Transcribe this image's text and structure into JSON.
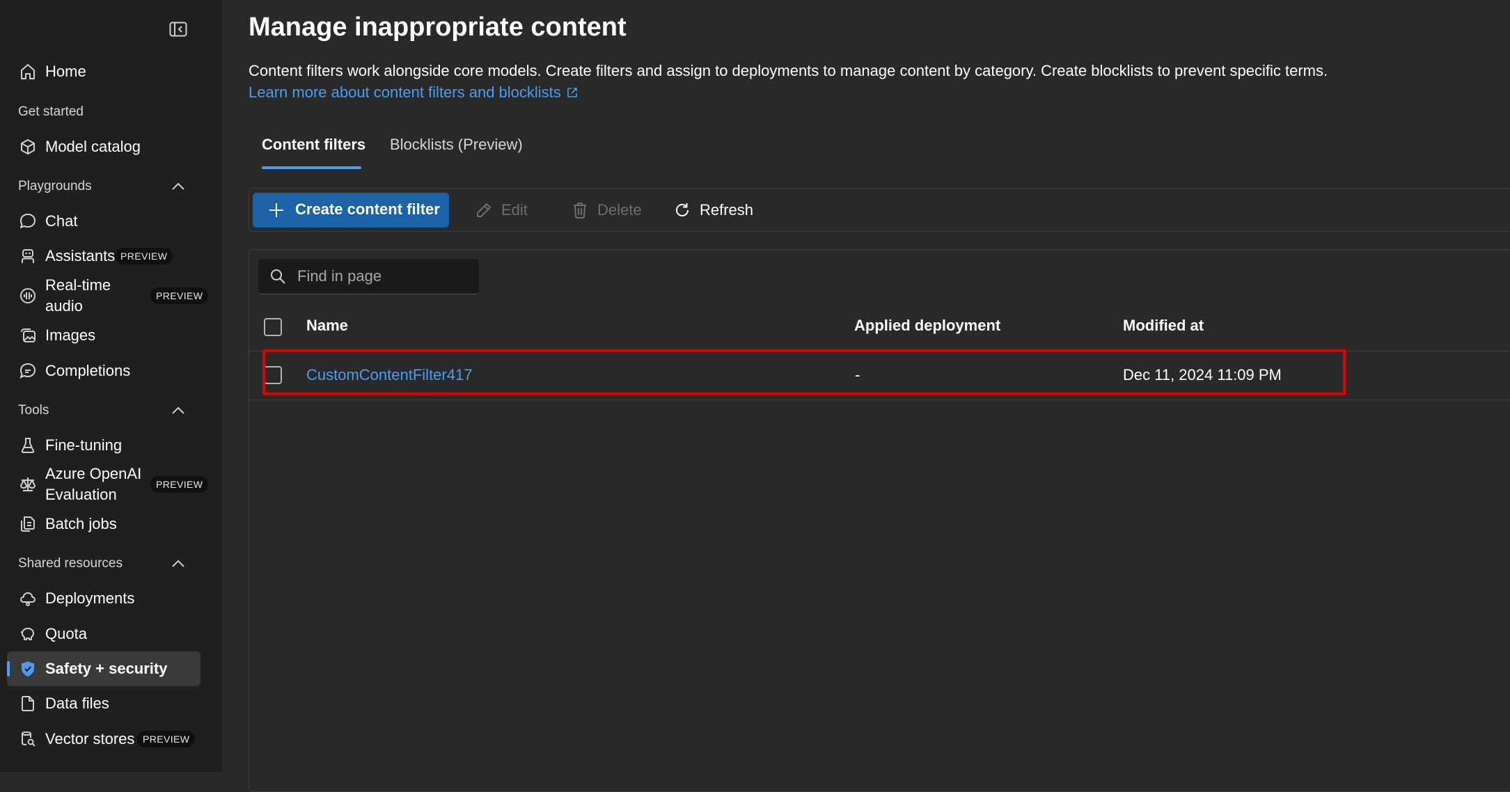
{
  "sidebar": {
    "home": "Home",
    "get_started": "Get started",
    "model_catalog": "Model catalog",
    "playgrounds": "Playgrounds",
    "chat": "Chat",
    "assistants": "Assistants",
    "realtime_line1": "Real-time",
    "realtime_line2": "audio",
    "images": "Images",
    "completions": "Completions",
    "tools": "Tools",
    "fine_tuning": "Fine-tuning",
    "eval_line1": "Azure OpenAI",
    "eval_line2": "Evaluation",
    "batch_jobs": "Batch jobs",
    "shared_resources": "Shared resources",
    "deployments": "Deployments",
    "quota": "Quota",
    "safety_security": "Safety + security",
    "data_files": "Data files",
    "vector_stores": "Vector stores",
    "preview_badge": "PREVIEW"
  },
  "main": {
    "title": "Manage inappropriate content",
    "description": "Content filters work alongside core models. Create filters and assign to deployments to manage content by category. Create blocklists to prevent specific terms.",
    "learn_more": "Learn more about content filters and blocklists",
    "tabs": [
      {
        "label": "Content filters",
        "selected": true
      },
      {
        "label": "Blocklists (Preview)",
        "selected": false
      }
    ],
    "toolbar": {
      "create": "Create content filter",
      "edit": "Edit",
      "delete": "Delete",
      "refresh": "Refresh"
    },
    "search": {
      "placeholder": "Find in page"
    },
    "table": {
      "columns": [
        "Name",
        "Applied deployment",
        "Modified at"
      ],
      "rows": [
        {
          "name": "CustomContentFilter417",
          "deployment": "-",
          "modified": "Dec 11, 2024 11:09 PM"
        }
      ]
    }
  },
  "colors": {
    "accent": "#479ef5",
    "primary_button": "#1c62a8",
    "highlight_border": "#e00000",
    "sidebar_bg": "#1f1f1f",
    "main_bg": "#292929"
  }
}
